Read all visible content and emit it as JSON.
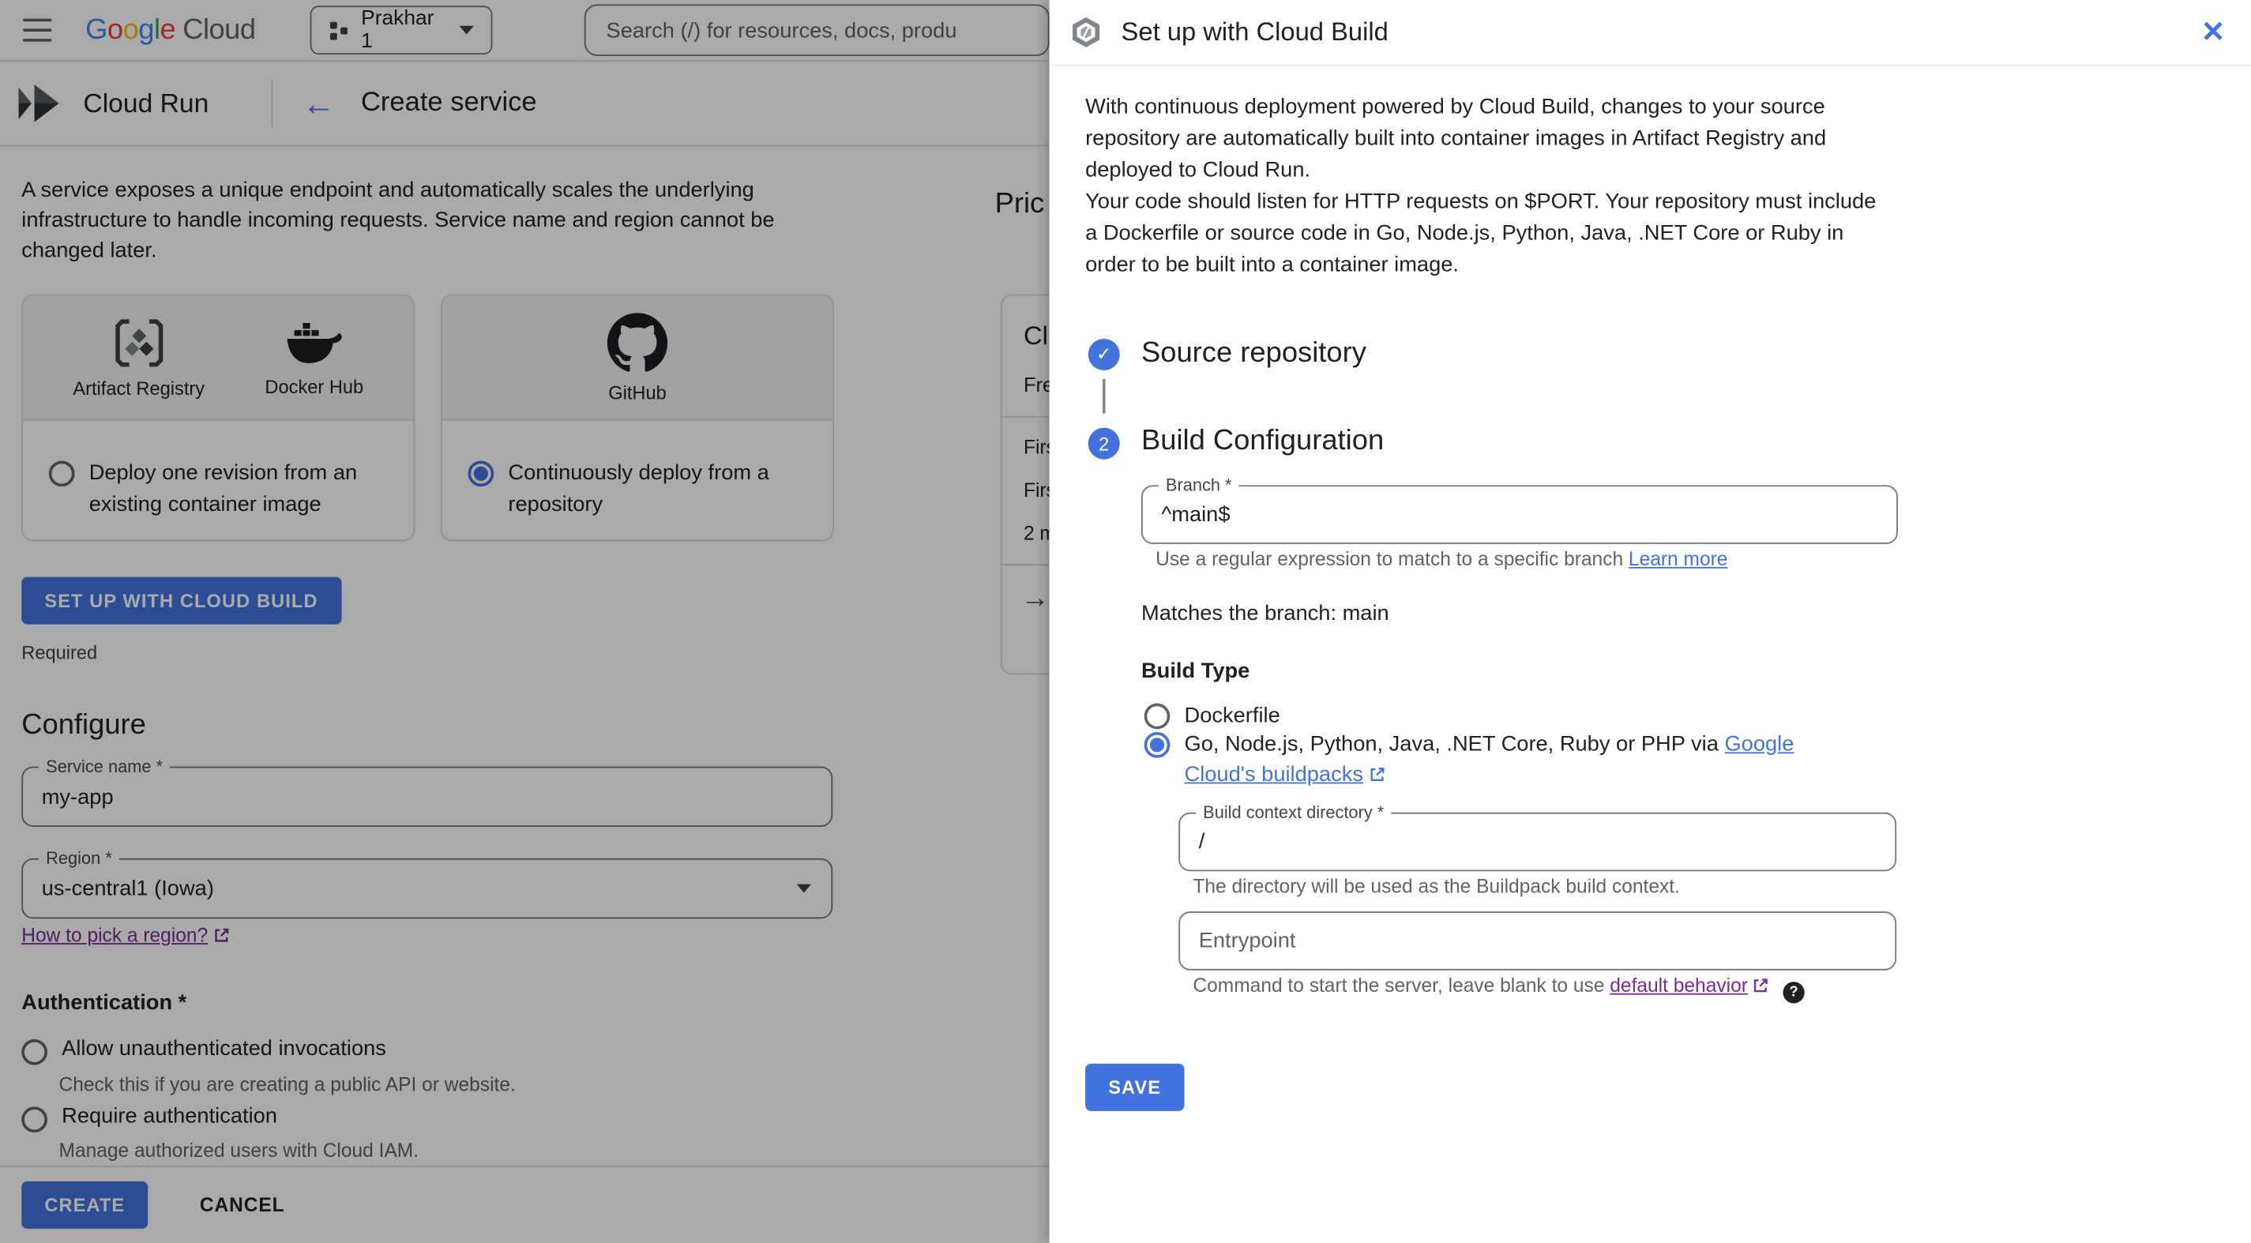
{
  "colors": {
    "accent_blue": "#4272de",
    "link_purple": "#7b2998",
    "scrim": "rgba(0,0,0,0.335)",
    "text_primary": "#202124",
    "text_secondary": "#5f6368",
    "border_gray": "#dadce0"
  },
  "icons": {
    "back_arrow": "←",
    "forward_arrow": "→",
    "close_x": "✕",
    "check": "✓",
    "help_q": "?"
  },
  "topbar": {
    "google_letters": [
      "G",
      "o",
      "o",
      "g",
      "l",
      "e"
    ],
    "cloud": "Cloud",
    "project": "Prakhar 1",
    "search_placeholder": "Search (/) for resources, docs, produ"
  },
  "productbar": {
    "product": "Cloud Run",
    "title": "Create service"
  },
  "intro": "A service exposes a unique endpoint and automatically scales the underlying infrastructure to handle incoming requests. Service name and region cannot be changed later.",
  "cards": {
    "registry": {
      "icons": [
        {
          "label": "Artifact Registry"
        },
        {
          "label": "Docker Hub"
        }
      ],
      "option": "Deploy one revision from an existing container image",
      "selected": false
    },
    "repo": {
      "icons": [
        {
          "label": "GitHub"
        }
      ],
      "option": "Continuously deploy from a repository",
      "selected": true
    }
  },
  "setup_button": "SET UP WITH CLOUD BUILD",
  "required": "Required",
  "configure": {
    "heading": "Configure",
    "service_name_label": "Service name *",
    "service_name_value": "my-app",
    "region_label": "Region *",
    "region_value": "us-central1 (Iowa)",
    "region_link": "How to pick a region?"
  },
  "authentication": {
    "heading": "Authentication *",
    "options": [
      {
        "label": "Allow unauthenticated invocations",
        "help": "Check this if you are creating a public API or website."
      },
      {
        "label": "Require authentication",
        "help": "Manage authorized users with Cloud IAM."
      }
    ]
  },
  "footer": {
    "create": "CREATE",
    "cancel": "CANCEL"
  },
  "pricing": {
    "heading": "Pric",
    "card": {
      "title": "Cl",
      "subtitle": "Fre",
      "rows": [
        "Firs",
        "Firs",
        "2 m"
      ]
    }
  },
  "panel": {
    "title": "Set up with Cloud Build",
    "description_1": "With continuous deployment powered by Cloud Build, changes to your source repository are automatically built into container images in Artifact Registry and deployed to Cloud Run.",
    "description_2": "Your code should listen for HTTP requests on $PORT. Your repository must include a Dockerfile or source code in Go, Node.js, Python, Java, .NET Core or Ruby in order to be built into a container image.",
    "steps": [
      {
        "number": "",
        "label": "Source repository",
        "state": "complete"
      },
      {
        "number": "2",
        "label": "Build Configuration",
        "state": "active"
      }
    ],
    "branch": {
      "label": "Branch *",
      "value": "^main$",
      "helper": "Use a regular expression to match to a specific branch ",
      "helper_link": "Learn more"
    },
    "match_note": "Matches the branch: main",
    "build_type": {
      "heading": "Build Type",
      "options": [
        {
          "label": "Dockerfile",
          "selected": false
        },
        {
          "label_prefix": "Go, Node.js, Python, Java, .NET Core, Ruby or PHP via ",
          "label_link": "Google Cloud's buildpacks",
          "selected": true
        }
      ]
    },
    "context_dir": {
      "label": "Build context directory *",
      "value": "/",
      "helper": "The directory will be used as the Buildpack build context."
    },
    "entrypoint": {
      "placeholder": "Entrypoint",
      "helper_prefix": "Command to start the server, leave blank to use ",
      "helper_link": "default behavior"
    },
    "save_button": "SAVE"
  }
}
